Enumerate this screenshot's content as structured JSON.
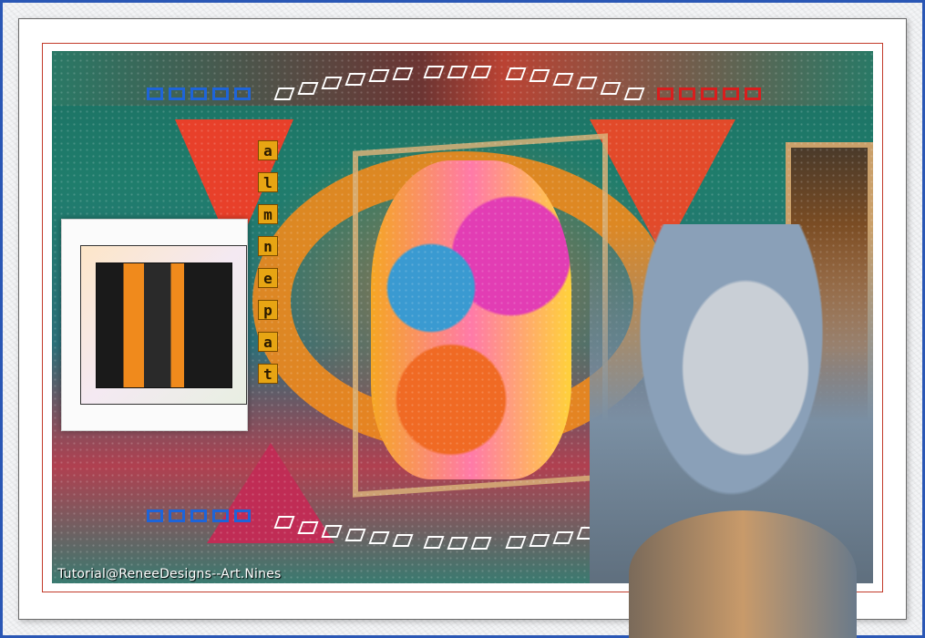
{
  "artwork": {
    "vertical_letters": [
      "a",
      "l",
      "m",
      "n",
      "e",
      "p",
      "a",
      "t"
    ],
    "credit": "Tutorial@ReneeDesigns--Art.Nines"
  }
}
